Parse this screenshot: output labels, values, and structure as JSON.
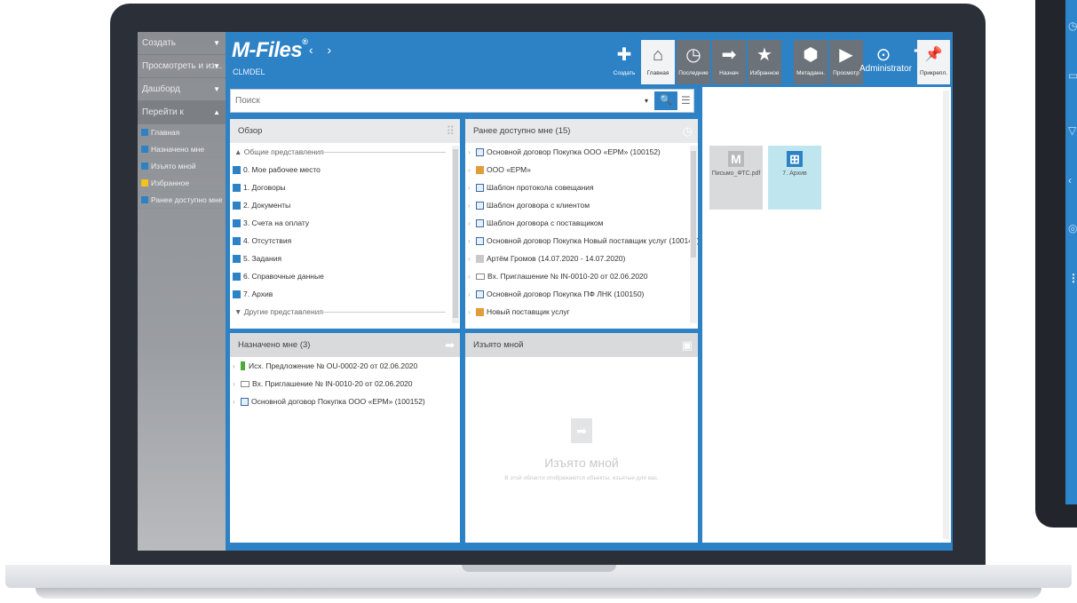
{
  "leftnav": {
    "sections": [
      {
        "label": "Создать",
        "arrow": "▼"
      },
      {
        "label": "Просмотреть и из...",
        "arrow": "▼"
      },
      {
        "label": "Дашборд",
        "arrow": "▼"
      },
      {
        "label": "Перейти к",
        "arrow": "▲"
      }
    ],
    "items": [
      {
        "label": "Главная",
        "icon": "home-icon",
        "color": "#2d82c6"
      },
      {
        "label": "Назначено мне",
        "icon": "arrow-icon",
        "color": "#2d82c6"
      },
      {
        "label": "Изъято мной",
        "icon": "checkout-icon",
        "color": "#2d82c6"
      },
      {
        "label": "Избранное",
        "icon": "star-icon",
        "color": "#f3c21c"
      },
      {
        "label": "Ранее доступно мне",
        "icon": "recent-icon",
        "color": "#2d82c6"
      }
    ]
  },
  "header": {
    "logo": "M-Files",
    "logo_mark": "®",
    "nav_arrows": "‹ ›",
    "vault": "CLMDEL",
    "toolbar": [
      {
        "label": "Создать",
        "glyph": "✚",
        "style": "plain"
      },
      {
        "label": "Главная",
        "glyph": "⌂",
        "style": "light"
      },
      {
        "label": "Последние",
        "glyph": "◷",
        "style": "dark"
      },
      {
        "label": "Назнач",
        "glyph": "➡",
        "style": "dark"
      },
      {
        "label": "Избранное",
        "glyph": "★",
        "style": "dark"
      }
    ],
    "right_toolbar": [
      {
        "label": "Метаданн.",
        "glyph": "⬢",
        "style": "dark"
      },
      {
        "label": "Просмотр",
        "glyph": "▶",
        "style": "dark"
      },
      {
        "label": "",
        "glyph": "⊙",
        "style": "plain"
      }
    ],
    "pin_label": "Прикрепл.",
    "pin_glyph": "📌",
    "user": "Administrator",
    "signal": "▂▄▆"
  },
  "search": {
    "placeholder": "Поиск",
    "dropdown": "▾",
    "button_glyph": "🔍",
    "filter_glyph": "☰"
  },
  "overview": {
    "title": "Обзор",
    "group_common": "▲ Общие представления",
    "items": [
      "0. Мое рабочее место",
      "1. Договоры",
      "2. Документы",
      "3. Счета на оплату",
      "4. Отсутствия",
      "5. Задания",
      "6. Справочные данные",
      "7. Архив"
    ],
    "group_other": "▼ Другие представления"
  },
  "recent": {
    "title": "Ранее доступно мне (15)",
    "items": [
      {
        "icon": "doc",
        "text": "Основной договор Покупка ООО «ЕРМ» (100152)"
      },
      {
        "icon": "group",
        "text": "ООО «ЕРМ»"
      },
      {
        "icon": "doc",
        "text": "Шаблон протокола совещания"
      },
      {
        "icon": "doc",
        "text": "Шаблон договора с клиентом"
      },
      {
        "icon": "doc",
        "text": "Шаблон договора с поставщиком"
      },
      {
        "icon": "doc",
        "text": "Основной договор Покупка Новый поставщик услуг (100149)"
      },
      {
        "icon": "person",
        "text": "Артём Громов (14.07.2020 - 14.07.2020)"
      },
      {
        "icon": "mail",
        "text": "Вх. Приглашение № IN-0010-20 от 02.06.2020"
      },
      {
        "icon": "doc",
        "text": "Основной договор Покупка ПФ ЛНК (100150)"
      },
      {
        "icon": "group",
        "text": "Новый поставщик услуг"
      }
    ]
  },
  "assigned": {
    "title": "Назначено мне (3)",
    "items": [
      {
        "icon": "battery",
        "text": "Исх. Предложение № OU-0002-20 от 02.06.2020"
      },
      {
        "icon": "mail",
        "text": "Вх. Приглашение № IN-0010-20 от 02.06.2020"
      },
      {
        "icon": "doc",
        "text": "Основной договор Покупка ООО «ЕРМ» (100152)"
      }
    ]
  },
  "checked_out": {
    "title": "Изъято мной",
    "empty_title": "Изъято мной",
    "empty_sub": "В этой области отображаются объекты, изъятые для вас."
  },
  "right_pane": {
    "tiles": [
      {
        "label": "Письмо_ФТС.pdf",
        "glyph": "M",
        "bg": "#d9dadc",
        "icon_bg": "#b8babd"
      },
      {
        "label": "7. Архив",
        "glyph": "⊞",
        "bg": "#bfe6ee",
        "icon_bg": "#2d82c6"
      }
    ]
  }
}
